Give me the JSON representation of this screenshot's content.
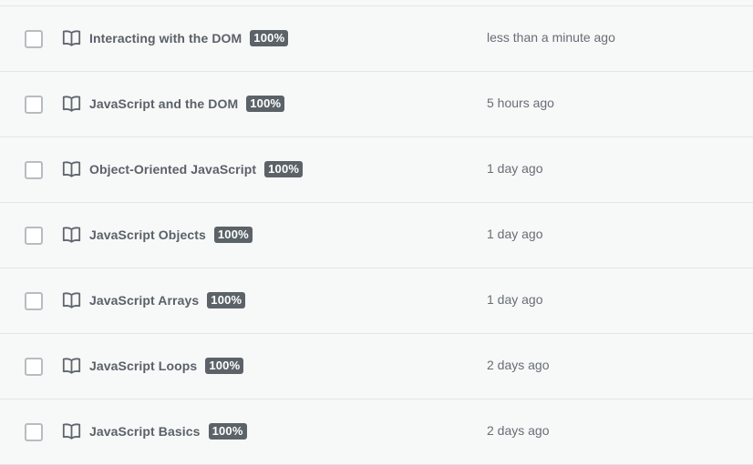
{
  "rows": [
    {
      "title": "Interacting with the DOM",
      "progress": "100%",
      "time": "less than a minute ago",
      "icon": "book-icon"
    },
    {
      "title": "JavaScript and the DOM",
      "progress": "100%",
      "time": "5 hours ago",
      "icon": "book-icon"
    },
    {
      "title": "Object-Oriented JavaScript",
      "progress": "100%",
      "time": "1 day ago",
      "icon": "book-icon"
    },
    {
      "title": "JavaScript Objects",
      "progress": "100%",
      "time": "1 day ago",
      "icon": "book-icon"
    },
    {
      "title": "JavaScript Arrays",
      "progress": "100%",
      "time": "1 day ago",
      "icon": "book-icon"
    },
    {
      "title": "JavaScript Loops",
      "progress": "100%",
      "time": "2 days ago",
      "icon": "book-icon"
    },
    {
      "title": "JavaScript Basics",
      "progress": "100%",
      "time": "2 days ago",
      "icon": "book-icon"
    }
  ],
  "colors": {
    "background": "#f7f8f8",
    "badge_background": "#5b6369",
    "badge_text": "#ffffff",
    "divider": "#e3e6e8",
    "checkbox_border": "#b7bcc1"
  }
}
